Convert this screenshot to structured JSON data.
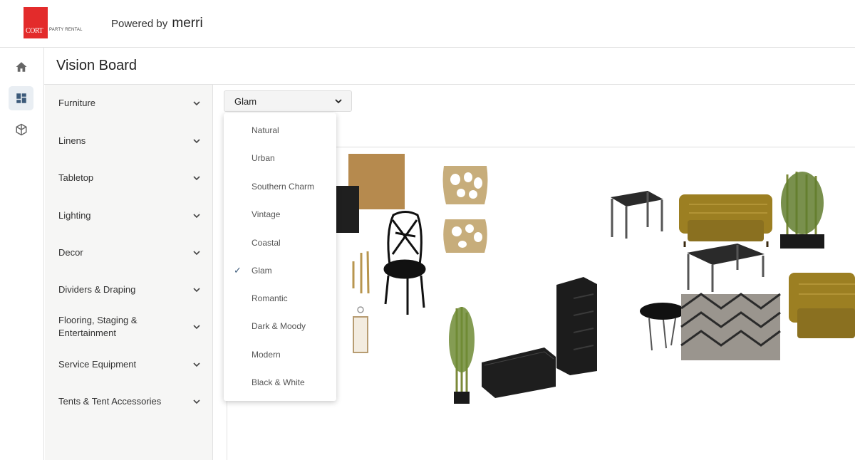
{
  "brand": {
    "logo_text": "CORT",
    "logo_subtitle": "PARTY RENTAL",
    "powered_by": "Powered by",
    "powered_brand": "merri"
  },
  "rail": {
    "items": [
      {
        "icon": "home-icon"
      },
      {
        "icon": "dashboard-icon",
        "active": true
      },
      {
        "icon": "cube-icon"
      }
    ]
  },
  "page": {
    "title": "Vision Board"
  },
  "sidebar": {
    "categories": [
      {
        "label": "Furniture"
      },
      {
        "label": "Linens"
      },
      {
        "label": "Tabletop"
      },
      {
        "label": "Lighting"
      },
      {
        "label": "Decor"
      },
      {
        "label": "Dividers & Draping"
      },
      {
        "label": "Flooring, Staging & Entertainment"
      },
      {
        "label": "Service Equipment"
      },
      {
        "label": "Tents & Tent Accessories"
      }
    ]
  },
  "style_select": {
    "value": "Glam",
    "options": [
      "Natural",
      "Urban",
      "Southern Charm",
      "Vintage",
      "Coastal",
      "Glam",
      "Romantic",
      "Dark & Moody",
      "Modern",
      "Black & White"
    ],
    "check": "✓"
  },
  "colors": {
    "logo_red": "#e32b2b",
    "gold": "#a8862f",
    "black": "#1c1c1c"
  }
}
